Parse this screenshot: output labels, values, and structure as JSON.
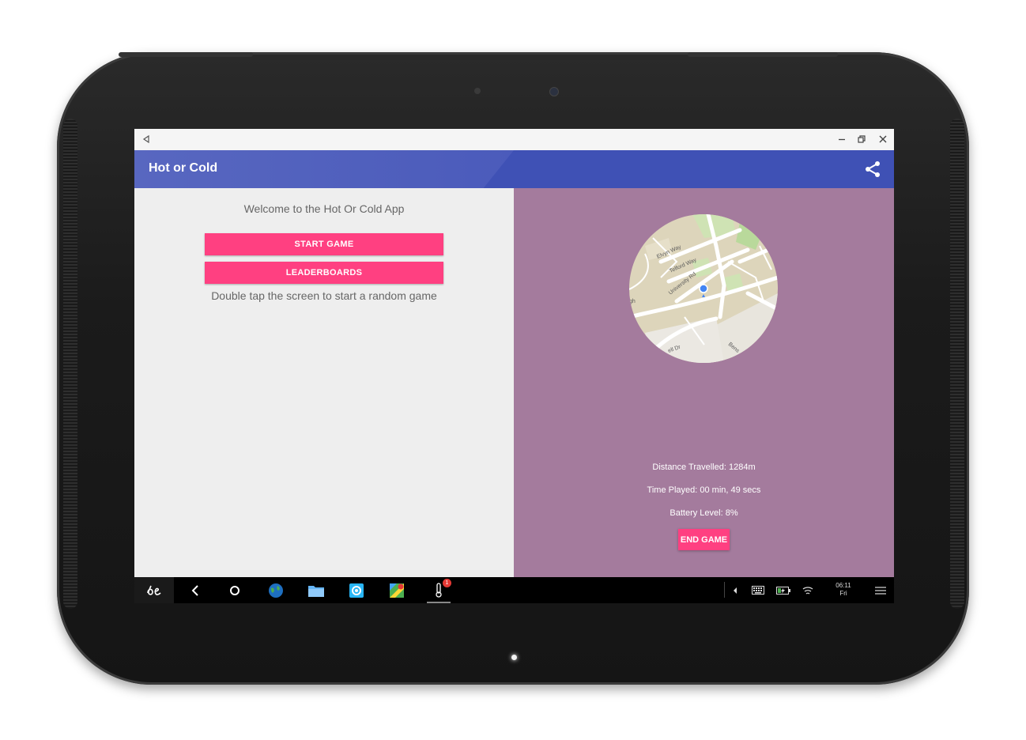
{
  "window": {
    "title": "Hot or Cold"
  },
  "left_panel": {
    "welcome": "Welcome to the Hot Or Cold App",
    "start_button": "START GAME",
    "leaderboards_button": "LEADERBOARDS",
    "hint": "Double tap the screen to start a random game"
  },
  "right_panel": {
    "map_labels": [
      "Elvyn Way",
      "Telford Way",
      "University Rd",
      "gh",
      "ell Dr",
      "Bens"
    ],
    "distance": "Distance Travelled: 1284m",
    "time": "Time Played: 00 min, 49 secs",
    "battery": "Battery Level: 8%",
    "end_button": "END GAME"
  },
  "taskbar": {
    "time": "06:11",
    "day": "Fri",
    "notification_count": "1",
    "icons": [
      "launcher-icon",
      "back-icon",
      "home-icon",
      "globe-icon",
      "folder-icon",
      "settings-icon",
      "maps-icon",
      "thermometer-icon",
      "arrow-icon",
      "keyboard-icon",
      "battery-icon",
      "wifi-icon",
      "menu-icon"
    ]
  },
  "colors": {
    "appbar": "#3f51b5",
    "accent": "#ff4081",
    "right_bg": "#a47b9d",
    "left_bg": "#eeeeee"
  }
}
